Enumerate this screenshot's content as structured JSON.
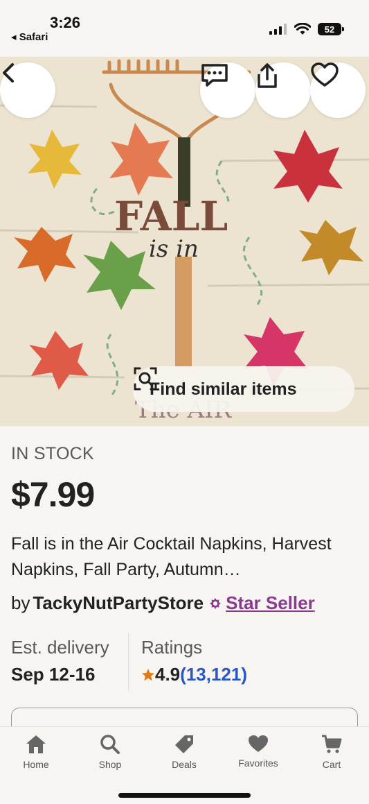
{
  "status_bar": {
    "time": "3:26",
    "back_app": "◂ Safari",
    "battery": "52"
  },
  "hero": {
    "image_text_top": "FALL",
    "image_text_mid": "is in",
    "image_text_bottom": "The AIR",
    "find_similar_label": "Find similar items"
  },
  "product": {
    "stock_status": "IN STOCK",
    "price": "$7.99",
    "title": "Fall is in the Air Cocktail Napkins, Harvest Napkins, Fall Party, Autumn…",
    "by_prefix": "by",
    "seller_name": "TackyNutPartyStore",
    "seller_badge": "Star Seller",
    "delivery_label": "Est. delivery",
    "delivery_value": "Sep 12-16",
    "ratings_label": "Ratings",
    "rating_value": "4.9",
    "rating_count": "(13,121)"
  },
  "tabbar": {
    "items": [
      {
        "label": "Home",
        "icon": "home-icon"
      },
      {
        "label": "Shop",
        "icon": "search-icon"
      },
      {
        "label": "Deals",
        "icon": "tag-icon"
      },
      {
        "label": "Favorites",
        "icon": "heart-icon"
      },
      {
        "label": "Cart",
        "icon": "cart-icon"
      }
    ]
  },
  "colors": {
    "accent_purple": "#8b3a8f",
    "link_blue": "#2a56c6",
    "star_orange": "#e07a12"
  }
}
